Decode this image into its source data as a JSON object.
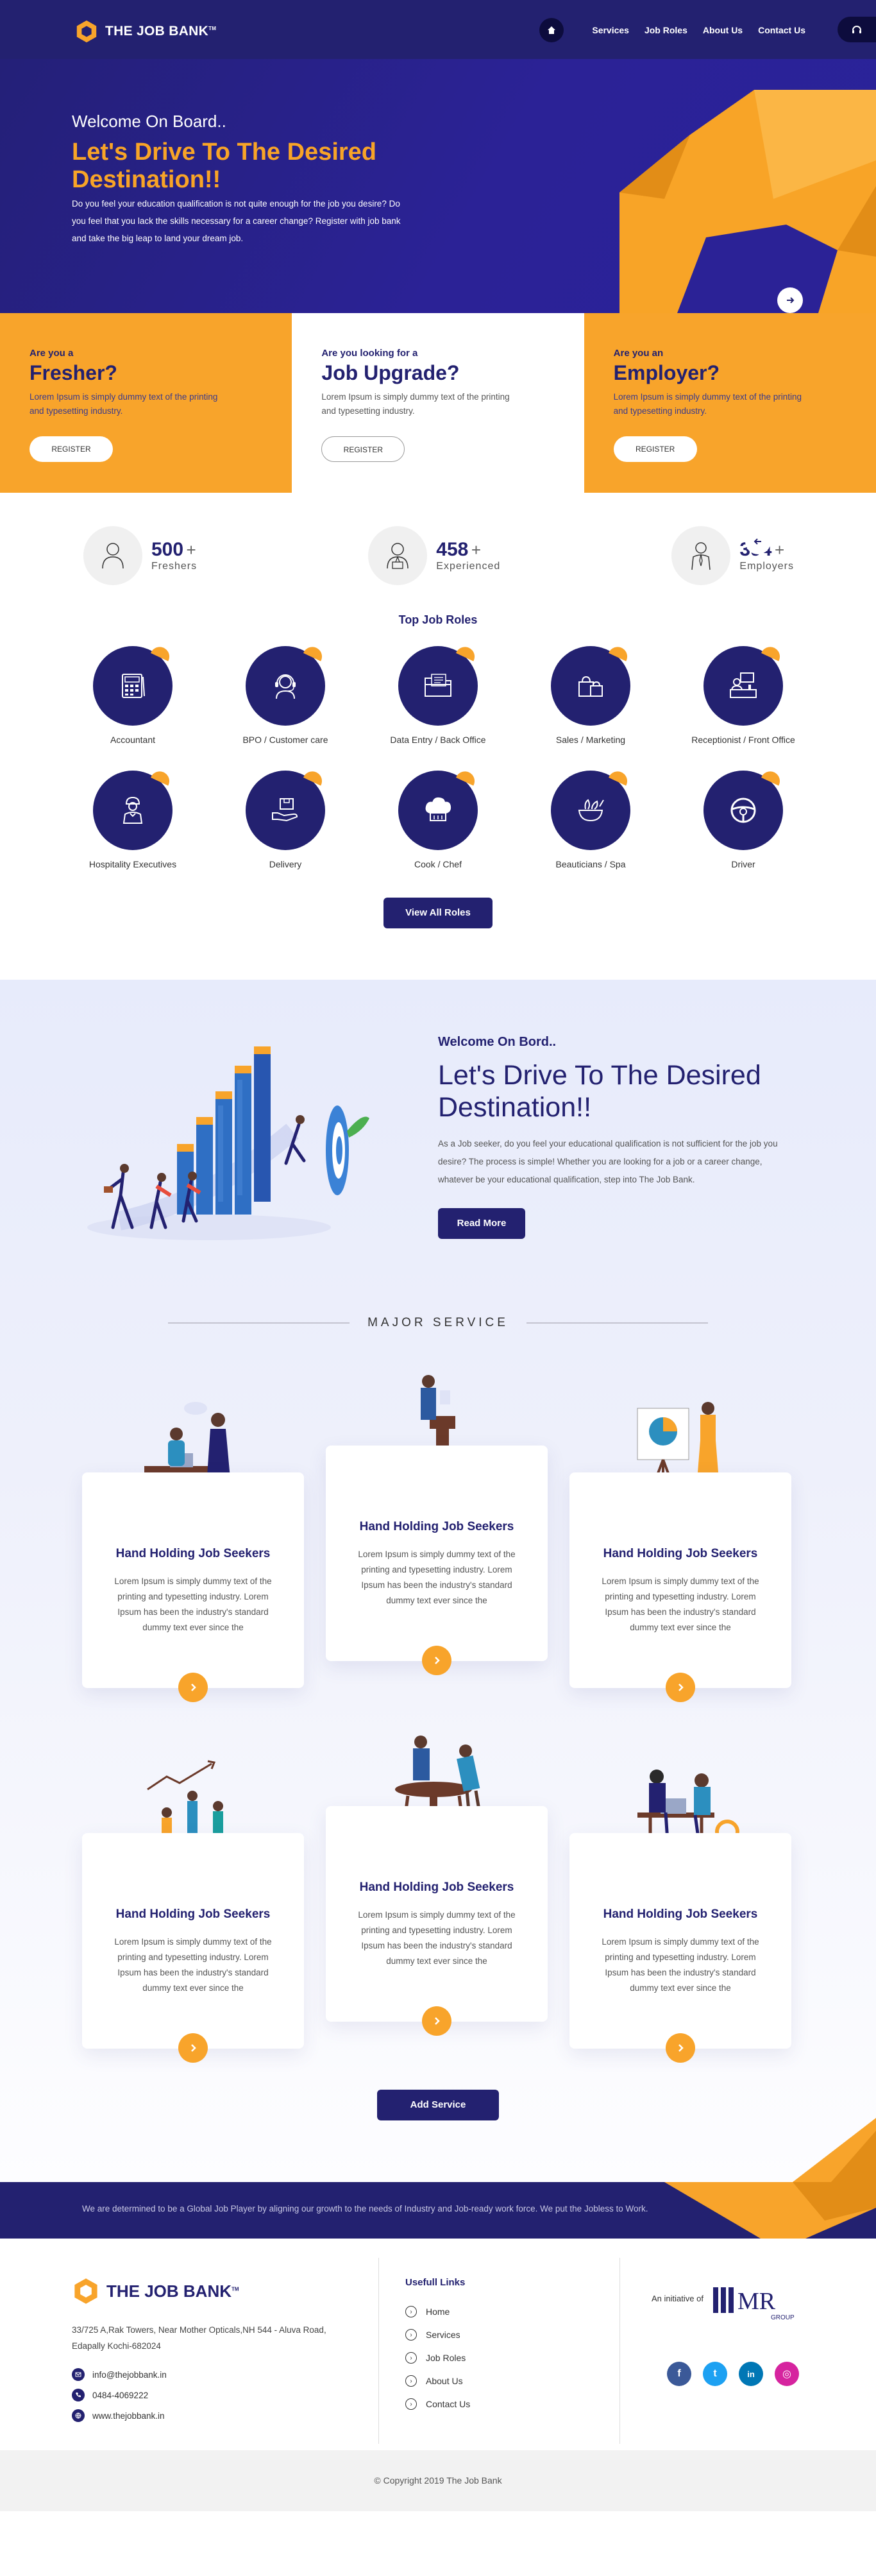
{
  "brand": {
    "name": "THE JOB BANK",
    "tm": "TM"
  },
  "nav": {
    "items": [
      "Services",
      "Job Roles",
      "About Us",
      "Contact Us"
    ]
  },
  "hero": {
    "welcome": "Welcome On Board..",
    "title": "Let's Drive To The Desired Destination!!",
    "text": "Do you feel your education qualification is not quite enough for the job you desire? Do you feel that you lack the skills necessary for a career change? Register with job bank and take the big leap to land your dream job."
  },
  "audience": [
    {
      "q": "Are you a",
      "big": "Fresher?",
      "desc": "Lorem Ipsum is simply dummy text of the printing and  typesetting industry.",
      "btn": "REGISTER"
    },
    {
      "q": "Are you looking for a",
      "big": "Job Upgrade?",
      "desc": "Lorem Ipsum is simply dummy text of the printing and  typesetting industry.",
      "btn": "REGISTER"
    },
    {
      "q": "Are you an",
      "big": "Employer?",
      "desc": "Lorem Ipsum is simply dummy text of the printing and  typesetting industry.",
      "btn": "REGISTER"
    }
  ],
  "stats": [
    {
      "num": "500",
      "plus": "+",
      "label": "Freshers",
      "icon": "user-icon"
    },
    {
      "num": "458",
      "plus": "+",
      "label": "Experienced",
      "icon": "professional-icon"
    },
    {
      "num": "394",
      "plus": "+",
      "label": "Employers",
      "icon": "employer-icon"
    }
  ],
  "roles": {
    "title": "Top Job Roles",
    "items": [
      {
        "label": "Accountant",
        "icon": "calculator-icon"
      },
      {
        "label": "BPO / Customer care",
        "icon": "headset-icon"
      },
      {
        "label": "Data Entry / Back Office",
        "icon": "folder-icon"
      },
      {
        "label": "Sales / Marketing",
        "icon": "shopping-bag-icon"
      },
      {
        "label": "Receptionist / Front Office",
        "icon": "reception-desk-icon"
      },
      {
        "label": "Hospitality Executives",
        "icon": "waiter-icon"
      },
      {
        "label": "Delivery",
        "icon": "package-hand-icon"
      },
      {
        "label": "Cook / Chef",
        "icon": "chef-hat-icon"
      },
      {
        "label": "Beauticians / Spa",
        "icon": "spa-bowl-icon"
      },
      {
        "label": "Driver",
        "icon": "steering-wheel-icon"
      }
    ],
    "button": "View All Roles"
  },
  "about": {
    "sub": "Welcome On Bord..",
    "title": "Let's Drive To The Desired Destination!!",
    "text": "As a Job seeker, do you feel your educational qualification is not sufficient for the job you desire? The process is simple! Whether you are looking for a job or a career change, whatever be your educational qualification, step into The Job Bank.",
    "button": "Read More"
  },
  "services": {
    "heading": "MAJOR SERVICE",
    "items": [
      {
        "title": "Hand Holding Job Seekers",
        "text": "Lorem Ipsum is simply dummy text of the printing and typesetting industry. Lorem Ipsum has been the industry's standard dummy text ever since the"
      },
      {
        "title": "Hand Holding Job Seekers",
        "text": "Lorem Ipsum is simply dummy text of the printing and typesetting industry. Lorem Ipsum has been the industry's standard dummy text ever since the"
      },
      {
        "title": "Hand Holding Job Seekers",
        "text": "Lorem Ipsum is simply dummy text of the printing and typesetting industry. Lorem Ipsum has been the industry's standard dummy text ever since the"
      },
      {
        "title": "Hand Holding Job Seekers",
        "text": "Lorem Ipsum is simply dummy text of the printing and typesetting industry. Lorem Ipsum has been the industry's standard dummy text ever since the"
      },
      {
        "title": "Hand Holding Job Seekers",
        "text": "Lorem Ipsum is simply dummy text of the printing and typesetting industry. Lorem Ipsum has been the industry's standard dummy text ever since the"
      },
      {
        "title": "Hand Holding Job Seekers",
        "text": "Lorem Ipsum is simply dummy text of the printing and typesetting industry. Lorem Ipsum has been the industry's standard dummy text ever since the"
      }
    ],
    "button": "Add Service"
  },
  "mission": "We are determined to be a Global Job Player by aligning our growth to the needs of Industry and Job-ready work force. We put the Jobless to Work.",
  "footer": {
    "address": "33/725 A,Rak Towers, Near Mother Opticals,NH 544 - Aluva Road, Edapally Kochi-682024",
    "email": "info@thejobbank.in",
    "phone": "0484-4069222",
    "website": "www.thejobbank.in",
    "links_title": "Usefull Links",
    "links": [
      "Home",
      "Services",
      "Job Roles",
      "About Us",
      "Contact Us"
    ],
    "initiative": "An initiative of",
    "partner_logo": {
      "main": "MR",
      "sub": "GROUP"
    },
    "socials": [
      {
        "name": "facebook-icon",
        "glyph": "f",
        "color": "#3b5998"
      },
      {
        "name": "twitter-icon",
        "glyph": "t",
        "color": "#1da1f2"
      },
      {
        "name": "linkedin-icon",
        "glyph": "in",
        "color": "#0077b5"
      },
      {
        "name": "instagram-icon",
        "glyph": "◎",
        "color": "#d6249f"
      }
    ],
    "copyright": "© Copyright 2019 The Job Bank"
  },
  "colors": {
    "navy": "#232170",
    "orange": "#f8a42b",
    "hero": "#2a239a"
  }
}
